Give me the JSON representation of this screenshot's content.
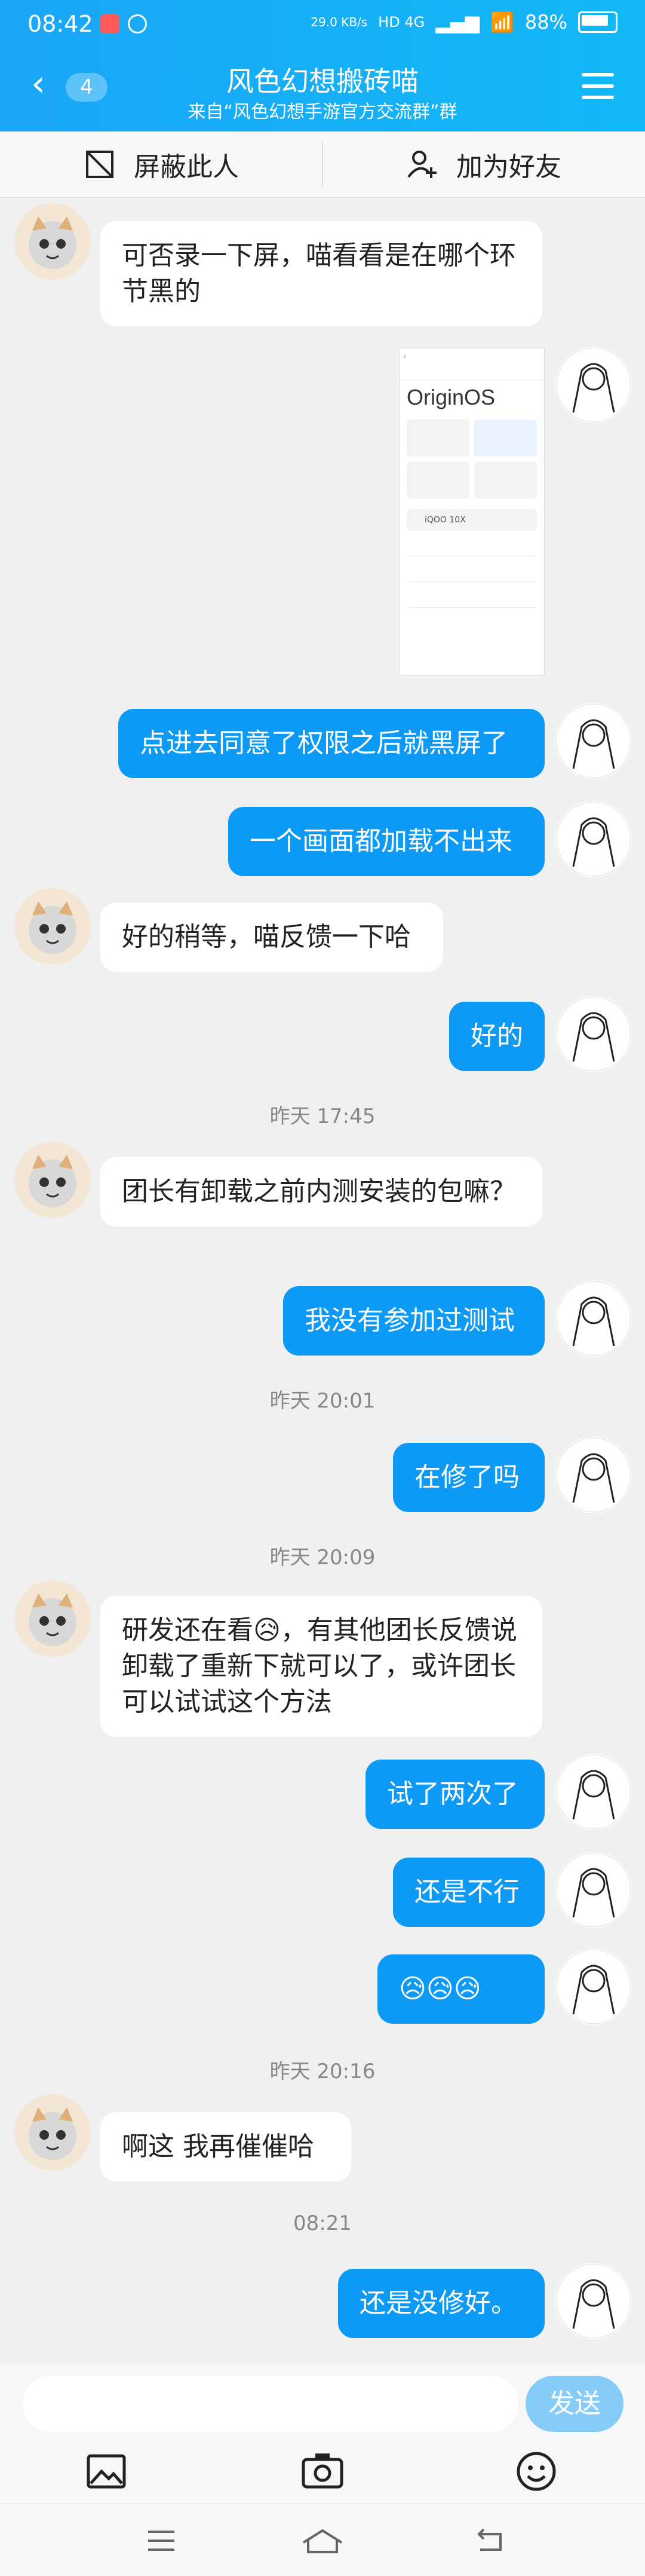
{
  "status_bar": {
    "time": "08:42",
    "net_speed": "29.0 KB/s",
    "signal": "HD 4G",
    "battery": "88%"
  },
  "header": {
    "back_count": "4",
    "title": "风色幻想搬砖喵",
    "subtitle": "来自“风色幻想手游官方交流群”群"
  },
  "actions": {
    "block_label": "屏蔽此人",
    "add_friend_label": "加为好友"
  },
  "screenshot_preview": {
    "os_label": "OriginOS",
    "device_name": "iQOO 10X"
  },
  "messages": [
    {
      "type": "in",
      "text": "可否录一下屏，喵看看是在哪个环节黑的"
    },
    {
      "type": "out",
      "text": "点进去同意了权限之后就黑屏了"
    },
    {
      "type": "out",
      "text": "一个画面都加载不出来"
    },
    {
      "type": "in",
      "text": "好的稍等，喵反馈一下哈"
    },
    {
      "type": "out",
      "text": "好的"
    },
    {
      "type": "time",
      "text": "昨天  17:45"
    },
    {
      "type": "in",
      "text": "团长有卸载之前内测安装的包嘛？"
    },
    {
      "type": "out",
      "text": "我没有参加过测试"
    },
    {
      "type": "time",
      "text": "昨天  20:01"
    },
    {
      "type": "out",
      "text": "在修了吗"
    },
    {
      "type": "time",
      "text": "昨天  20:09"
    },
    {
      "type": "in",
      "text": "研发还在看😥，有其他团长反馈说卸载了重新下就可以了，或许团长可以试试这个方法"
    },
    {
      "type": "out",
      "text": "试了两次了"
    },
    {
      "type": "out",
      "text": "还是不行"
    },
    {
      "type": "out",
      "text": "😥😥😥"
    },
    {
      "type": "time",
      "text": "昨天  20:16"
    },
    {
      "type": "in",
      "text": "啊这  我再催催哈"
    },
    {
      "type": "time",
      "text": "08:21"
    },
    {
      "type": "out",
      "text": "还是没修好。"
    }
  ],
  "input": {
    "send_label": "发送"
  }
}
